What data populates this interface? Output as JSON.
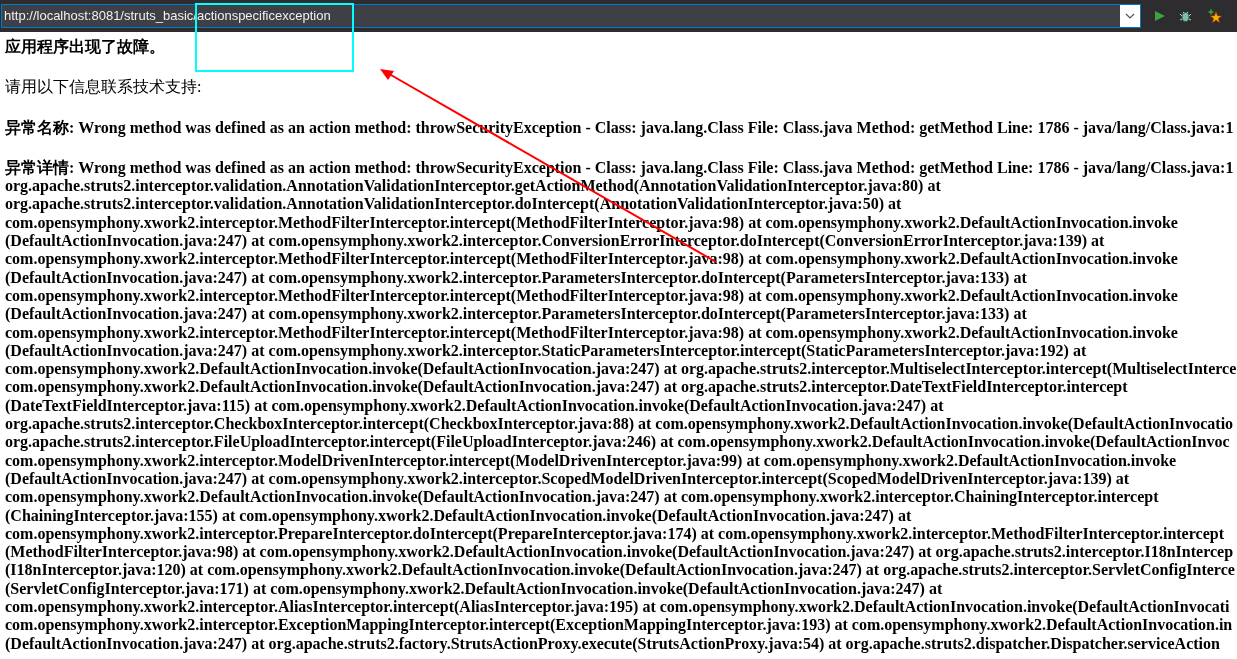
{
  "address_bar": {
    "url": "http://localhost:8081/struts_basic/actionspecificexception"
  },
  "page": {
    "heading": "应用程序出现了故障。",
    "intro": "请用以下信息联系技术支持:",
    "fields": [
      {
        "label": "异常名称:",
        "value": "Wrong method was defined as an action method: throwSecurityException - Class: java.lang.Class File: Class.java Method: getMethod Line: 1786 - java/lang/Class.java:1"
      },
      {
        "label": "异常详情:",
        "value": "Wrong method was defined as an action method: throwSecurityException - Class: java.lang.Class File: Class.java Method: getMethod Line: 1786 - java/lang/Class.java:1"
      }
    ],
    "stack_trace": [
      "org.apache.struts2.interceptor.validation.AnnotationValidationInterceptor.getActionMethod(AnnotationValidationInterceptor.java:80) at",
      "org.apache.struts2.interceptor.validation.AnnotationValidationInterceptor.doIntercept(AnnotationValidationInterceptor.java:50) at",
      "com.opensymphony.xwork2.interceptor.MethodFilterInterceptor.intercept(MethodFilterInterceptor.java:98) at com.opensymphony.xwork2.DefaultActionInvocation.invoke",
      "(DefaultActionInvocation.java:247) at com.opensymphony.xwork2.interceptor.ConversionErrorInterceptor.doIntercept(ConversionErrorInterceptor.java:139) at",
      "com.opensymphony.xwork2.interceptor.MethodFilterInterceptor.intercept(MethodFilterInterceptor.java:98) at com.opensymphony.xwork2.DefaultActionInvocation.invoke",
      "(DefaultActionInvocation.java:247) at com.opensymphony.xwork2.interceptor.ParametersInterceptor.doIntercept(ParametersInterceptor.java:133) at",
      "com.opensymphony.xwork2.interceptor.MethodFilterInterceptor.intercept(MethodFilterInterceptor.java:98) at com.opensymphony.xwork2.DefaultActionInvocation.invoke",
      "(DefaultActionInvocation.java:247) at com.opensymphony.xwork2.interceptor.ParametersInterceptor.doIntercept(ParametersInterceptor.java:133) at",
      "com.opensymphony.xwork2.interceptor.MethodFilterInterceptor.intercept(MethodFilterInterceptor.java:98) at com.opensymphony.xwork2.DefaultActionInvocation.invoke",
      "(DefaultActionInvocation.java:247) at com.opensymphony.xwork2.interceptor.StaticParametersInterceptor.intercept(StaticParametersInterceptor.java:192) at",
      "com.opensymphony.xwork2.DefaultActionInvocation.invoke(DefaultActionInvocation.java:247) at org.apache.struts2.interceptor.MultiselectInterceptor.intercept(MultiselectInterce",
      "com.opensymphony.xwork2.DefaultActionInvocation.invoke(DefaultActionInvocation.java:247) at org.apache.struts2.interceptor.DateTextFieldInterceptor.intercept",
      "(DateTextFieldInterceptor.java:115) at com.opensymphony.xwork2.DefaultActionInvocation.invoke(DefaultActionInvocation.java:247) at",
      "org.apache.struts2.interceptor.CheckboxInterceptor.intercept(CheckboxInterceptor.java:88) at com.opensymphony.xwork2.DefaultActionInvocation.invoke(DefaultActionInvocatio",
      "org.apache.struts2.interceptor.FileUploadInterceptor.intercept(FileUploadInterceptor.java:246) at com.opensymphony.xwork2.DefaultActionInvocation.invoke(DefaultActionInvoc",
      "com.opensymphony.xwork2.interceptor.ModelDrivenInterceptor.intercept(ModelDrivenInterceptor.java:99) at com.opensymphony.xwork2.DefaultActionInvocation.invoke",
      "(DefaultActionInvocation.java:247) at com.opensymphony.xwork2.interceptor.ScopedModelDrivenInterceptor.intercept(ScopedModelDrivenInterceptor.java:139) at",
      "com.opensymphony.xwork2.DefaultActionInvocation.invoke(DefaultActionInvocation.java:247) at com.opensymphony.xwork2.interceptor.ChainingInterceptor.intercept",
      "(ChainingInterceptor.java:155) at com.opensymphony.xwork2.DefaultActionInvocation.invoke(DefaultActionInvocation.java:247) at",
      "com.opensymphony.xwork2.interceptor.PrepareInterceptor.doIntercept(PrepareInterceptor.java:174) at com.opensymphony.xwork2.interceptor.MethodFilterInterceptor.intercept",
      "(MethodFilterInterceptor.java:98) at com.opensymphony.xwork2.DefaultActionInvocation.invoke(DefaultActionInvocation.java:247) at org.apache.struts2.interceptor.I18nIntercep",
      "(I18nInterceptor.java:120) at com.opensymphony.xwork2.DefaultActionInvocation.invoke(DefaultActionInvocation.java:247) at org.apache.struts2.interceptor.ServletConfigInterce",
      "(ServletConfigInterceptor.java:171) at com.opensymphony.xwork2.DefaultActionInvocation.invoke(DefaultActionInvocation.java:247) at",
      "com.opensymphony.xwork2.interceptor.AliasInterceptor.intercept(AliasInterceptor.java:195) at com.opensymphony.xwork2.DefaultActionInvocation.invoke(DefaultActionInvocati",
      "com.opensymphony.xwork2.interceptor.ExceptionMappingInterceptor.intercept(ExceptionMappingInterceptor.java:193) at com.opensymphony.xwork2.DefaultActionInvocation.in",
      "(DefaultActionInvocation.java:247) at org.apache.struts2.factory.StrutsActionProxy.execute(StrutsActionProxy.java:54) at org.apache.struts2.dispatcher.Dispatcher.serviceAction"
    ]
  },
  "annotations": [
    {
      "kind": "rectangle",
      "color": "#00ffff"
    },
    {
      "kind": "arrow",
      "color": "#ff0000"
    }
  ]
}
